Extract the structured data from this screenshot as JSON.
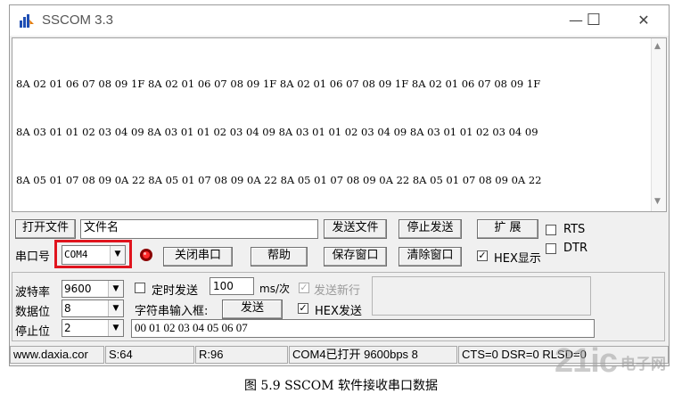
{
  "window": {
    "title": "SSCOM 3.3",
    "minimize_label": "—",
    "maximize_label": "☐",
    "close_label": "✕"
  },
  "receive": {
    "lines": [
      "8A 02 01 06 07 08 09 1F 8A 02 01 06 07 08 09 1F 8A 02 01 06 07 08 09 1F 8A 02 01 06 07 08 09 1F",
      "8A 03 01 01 02 03 04 09 8A 03 01 01 02 03 04 09 8A 03 01 01 02 03 04 09 8A 03 01 01 02 03 04 09",
      "8A 05 01 07 08 09 0A 22 8A 05 01 07 08 09 0A 22 8A 05 01 07 08 09 0A 22 8A 05 01 07 08 09 0A 22"
    ]
  },
  "row1": {
    "open_file_label": "打开文件",
    "file_name_value": "文件名",
    "send_file_label": "发送文件",
    "stop_send_label": "停止发送",
    "expand_label": "扩 展",
    "rts_label": "RTS"
  },
  "row2": {
    "port_label": "串口号",
    "port_value": "COM4",
    "close_port_label": "关闭串口",
    "help_label": "帮助",
    "save_window_label": "保存窗口",
    "clear_window_label": "清除窗口",
    "hex_display_label": "HEX显示",
    "dtr_label": "DTR"
  },
  "settings": {
    "baud_label": "波特率",
    "baud_value": "9600",
    "databits_label": "数据位",
    "databits_value": "8",
    "stopbits_label": "停止位",
    "stopbits_value": "2",
    "timed_send_label": "定时发送",
    "interval_value": "100",
    "interval_unit": "ms/次",
    "send_newline_label": "发送新行",
    "string_input_label": "字符串输入框:",
    "send_label": "发送",
    "hex_send_label": "HEX发送",
    "send_data_value": "00 01 02 03 04 05 06 07"
  },
  "status": {
    "website": "www.daxia.cor",
    "sent": "S:64",
    "received": "R:96",
    "port_state": "COM4已打开  9600bps  8",
    "signals": "CTS=0 DSR=0 RLSD=0"
  },
  "caption": "图 5.9 SSCOM 软件接收串口数据",
  "watermark": {
    "brand": "21ic",
    "text": "电子网"
  },
  "colors": {
    "highlight_box": "#e0141e",
    "window_bg": "#f0f0f0"
  }
}
